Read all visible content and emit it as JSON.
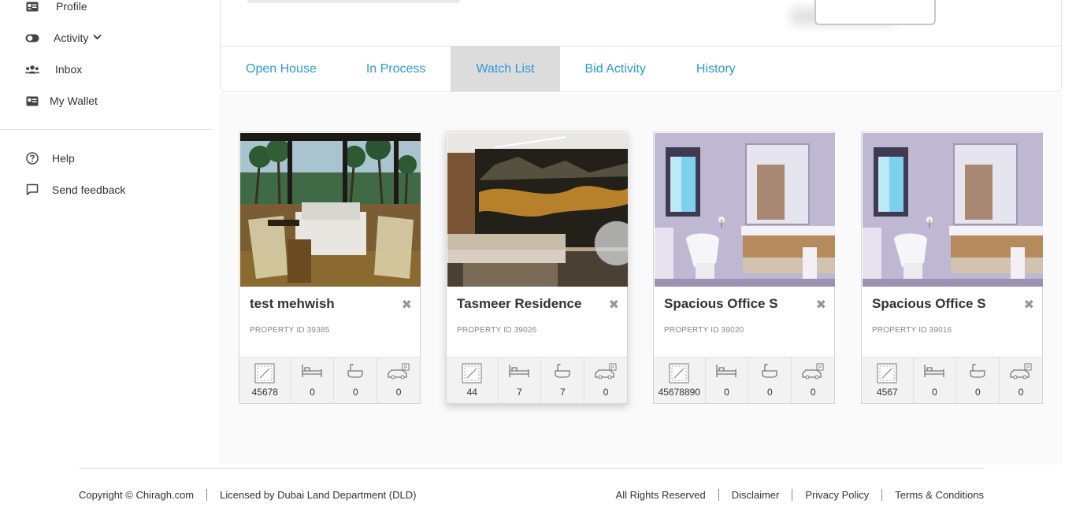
{
  "sidebar": {
    "items": [
      {
        "label": "Profile",
        "icon": "id-card-icon"
      },
      {
        "label": "Activity",
        "icon": "toggle-icon"
      },
      {
        "label": "Inbox",
        "icon": "users-icon"
      },
      {
        "label": "My Wallet",
        "icon": "wallet-icon"
      },
      {
        "label": "Help",
        "icon": "help-circle-icon"
      },
      {
        "label": "Send feedback",
        "icon": "feedback-icon"
      }
    ]
  },
  "tabs": [
    {
      "label": "Open House",
      "active": false
    },
    {
      "label": "In Process",
      "active": false
    },
    {
      "label": "Watch List",
      "active": true
    },
    {
      "label": "Bid Activity",
      "active": false
    },
    {
      "label": "History",
      "active": false
    }
  ],
  "cards": [
    {
      "title": "test mehwish",
      "property_id": "PROPERTY ID 39385",
      "area": "45678",
      "bedrooms": "0",
      "bathrooms": "0",
      "parking": "0"
    },
    {
      "title": "Tasmeer Residence",
      "property_id": "PROPERTY ID 39026",
      "area": "44",
      "bedrooms": "7",
      "bathrooms": "7",
      "parking": "0"
    },
    {
      "title": "Spacious Office S",
      "property_id": "PROPERTY ID 39020",
      "area": "45678890",
      "bedrooms": "0",
      "bathrooms": "0",
      "parking": "0"
    },
    {
      "title": "Spacious Office S",
      "property_id": "PROPERTY ID 39016",
      "area": "4567",
      "bedrooms": "0",
      "bathrooms": "0",
      "parking": "0"
    }
  ],
  "footer": {
    "copyright": "Copyright © Chiragh.com",
    "license": "Licensed by Dubai Land Department (DLD)",
    "rights": "All Rights Reserved",
    "disclaimer": "Disclaimer",
    "privacy": "Privacy Policy",
    "terms": "Terms & Conditions"
  },
  "colors": {
    "accent": "#2d9ad8",
    "active_tab_bg": "#dcdcdc"
  }
}
